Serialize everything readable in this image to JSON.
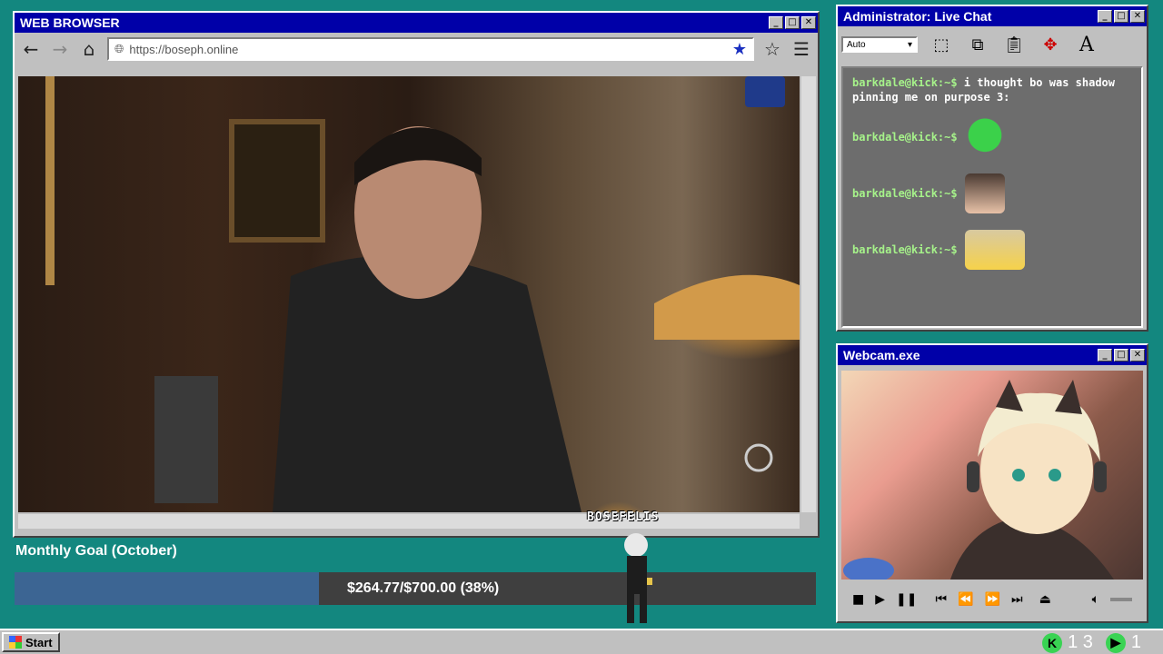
{
  "colors": {
    "desktop": "#13877f",
    "titlebar": "#0000a8",
    "goal_fill": "#3c6593",
    "kick_green": "#39d353"
  },
  "browser": {
    "title": "WEB BROWSER",
    "url": "https://boseph.online"
  },
  "chat": {
    "title": "Administrator: Live Chat",
    "font_size_select": "Auto",
    "messages": [
      {
        "user": "barkdale@kick:~$",
        "text": "i thought bo was shadow pinning me on purpose 3:"
      },
      {
        "user": "barkdale@kick:~$",
        "text": "",
        "emote": "green-blob-emote"
      },
      {
        "user": "barkdale@kick:~$",
        "text": "",
        "emote": "photo-emote"
      },
      {
        "user": "barkdale@kick:~$",
        "text": "",
        "emote": "pikachu-emote"
      }
    ]
  },
  "webcam": {
    "title": "Webcam.exe"
  },
  "goal": {
    "title": "Monthly Goal (October)",
    "progress_text": "$264.77/$700.00 (38%)",
    "progress": 0.38
  },
  "overlay": {
    "name_tag": "BOSEFELIS"
  },
  "taskbar": {
    "start_label": "Start",
    "viewers_label": "1 3",
    "followers_label": "1"
  },
  "icons": {
    "back": "arrow-left-icon",
    "forward": "arrow-right-icon",
    "home": "home-icon",
    "bookmark": "star-filled-icon",
    "favorites": "star-outline-icon",
    "menu": "hamburger-icon",
    "globe": "globe-icon"
  }
}
